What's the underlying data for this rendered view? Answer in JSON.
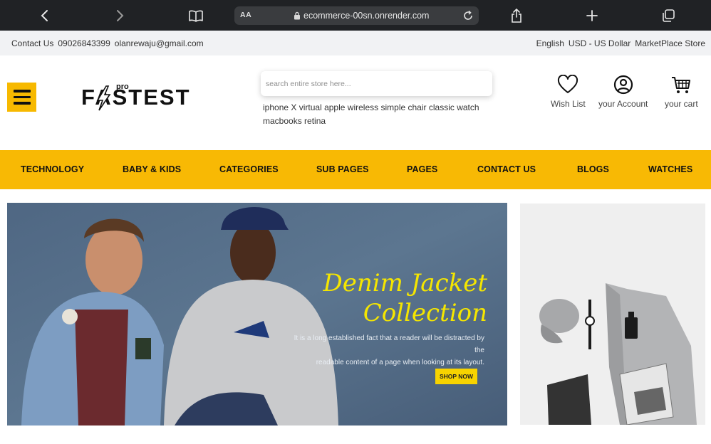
{
  "browser": {
    "text_size_label": "AA",
    "url": "ecommerce-00sn.onrender.com"
  },
  "topbar": {
    "contact_label": "Contact Us",
    "phone": "09026843399",
    "email": "olanrewaju@gmail.com",
    "language": "English",
    "currency": "USD - US Dollar",
    "store": "MarketPlace Store"
  },
  "header": {
    "logo_text": "FASTEST",
    "logo_sup": "pro",
    "search_placeholder": "search entire store here...",
    "suggestions": [
      "iphone X",
      "virtual",
      "apple",
      "wireless",
      "simple chair",
      "classic watch",
      "macbooks",
      "retina"
    ],
    "wishlist_label": "Wish List",
    "account_label": "your Account",
    "cart_label": "your cart"
  },
  "nav": {
    "items": [
      "TECHNOLOGY",
      "BABY & KIDS",
      "CATEGORIES",
      "SUB PAGES",
      "PAGES",
      "CONTACT US",
      "BLOGS",
      "WATCHES"
    ]
  },
  "banner": {
    "title_line1": "Denim Jacket",
    "title_line2": "Collection",
    "text_line1": "It is a long established fact that a reader will be distracted  by the",
    "text_line2": "readable content of a page when looking at its layout.",
    "button_label": "SHOP NOW"
  },
  "colors": {
    "accent": "#f8b904",
    "chrome": "#202225",
    "topbar": "#f1f2f4"
  }
}
